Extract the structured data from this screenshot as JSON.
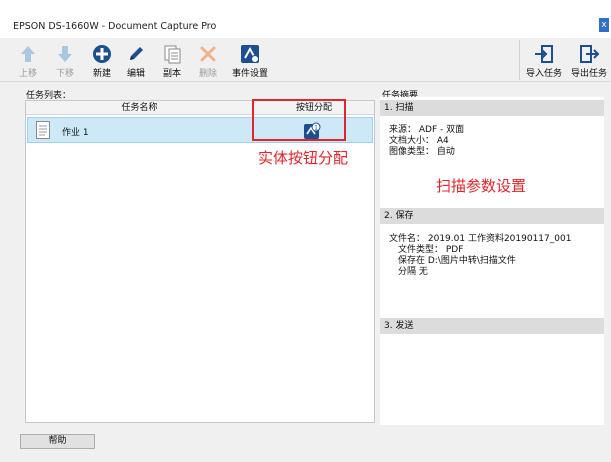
{
  "window": {
    "title": "EPSON DS-1660W - Document Capture Pro",
    "close_glyph": "x"
  },
  "toolbar": {
    "up": "上移",
    "down": "下移",
    "new": "新建",
    "edit": "编辑",
    "copy": "副本",
    "delete": "删除",
    "event_settings": "事件设置",
    "import_task": "导入任务",
    "export_task": "导出任务"
  },
  "task_list": {
    "label": "任务列表：",
    "columns": [
      "任务名称",
      "按钮分配"
    ],
    "rows": [
      {
        "name": "作业 1"
      }
    ]
  },
  "annotations": {
    "button_assign": "实体按钮分配",
    "scan_params": "扫描参数设置",
    "color": "#e0252b"
  },
  "summary": {
    "label": "任务摘要",
    "scan": {
      "header": "1. 扫描",
      "lines": [
        "来源： ADF - 双面",
        "文档大小： A4",
        "图像类型： 自动"
      ]
    },
    "save": {
      "header": "2. 保存",
      "lines": [
        "文件名： 2019.01 工作资料20190117_001",
        "文件类型： PDF",
        "保存在 D:\\图片中转\\扫描文件",
        "分隔 无"
      ]
    },
    "send": {
      "header": "3. 发送"
    }
  },
  "footer": {
    "help": "帮助"
  }
}
